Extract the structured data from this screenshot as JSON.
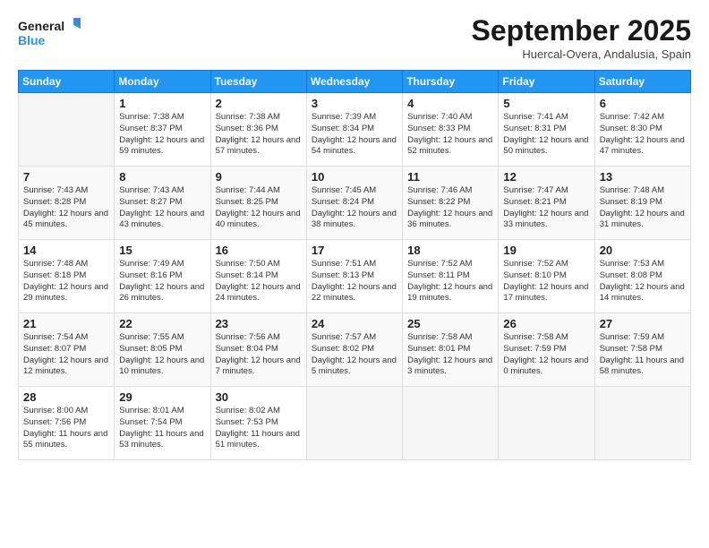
{
  "logo": {
    "line1": "General",
    "line2": "Blue"
  },
  "title": "September 2025",
  "location": "Huercal-Overa, Andalusia, Spain",
  "days_of_week": [
    "Sunday",
    "Monday",
    "Tuesday",
    "Wednesday",
    "Thursday",
    "Friday",
    "Saturday"
  ],
  "weeks": [
    [
      {
        "day": "",
        "sunrise": "",
        "sunset": "",
        "daylight": ""
      },
      {
        "day": "1",
        "sunrise": "Sunrise: 7:38 AM",
        "sunset": "Sunset: 8:37 PM",
        "daylight": "Daylight: 12 hours and 59 minutes."
      },
      {
        "day": "2",
        "sunrise": "Sunrise: 7:38 AM",
        "sunset": "Sunset: 8:36 PM",
        "daylight": "Daylight: 12 hours and 57 minutes."
      },
      {
        "day": "3",
        "sunrise": "Sunrise: 7:39 AM",
        "sunset": "Sunset: 8:34 PM",
        "daylight": "Daylight: 12 hours and 54 minutes."
      },
      {
        "day": "4",
        "sunrise": "Sunrise: 7:40 AM",
        "sunset": "Sunset: 8:33 PM",
        "daylight": "Daylight: 12 hours and 52 minutes."
      },
      {
        "day": "5",
        "sunrise": "Sunrise: 7:41 AM",
        "sunset": "Sunset: 8:31 PM",
        "daylight": "Daylight: 12 hours and 50 minutes."
      },
      {
        "day": "6",
        "sunrise": "Sunrise: 7:42 AM",
        "sunset": "Sunset: 8:30 PM",
        "daylight": "Daylight: 12 hours and 47 minutes."
      }
    ],
    [
      {
        "day": "7",
        "sunrise": "Sunrise: 7:43 AM",
        "sunset": "Sunset: 8:28 PM",
        "daylight": "Daylight: 12 hours and 45 minutes."
      },
      {
        "day": "8",
        "sunrise": "Sunrise: 7:43 AM",
        "sunset": "Sunset: 8:27 PM",
        "daylight": "Daylight: 12 hours and 43 minutes."
      },
      {
        "day": "9",
        "sunrise": "Sunrise: 7:44 AM",
        "sunset": "Sunset: 8:25 PM",
        "daylight": "Daylight: 12 hours and 40 minutes."
      },
      {
        "day": "10",
        "sunrise": "Sunrise: 7:45 AM",
        "sunset": "Sunset: 8:24 PM",
        "daylight": "Daylight: 12 hours and 38 minutes."
      },
      {
        "day": "11",
        "sunrise": "Sunrise: 7:46 AM",
        "sunset": "Sunset: 8:22 PM",
        "daylight": "Daylight: 12 hours and 36 minutes."
      },
      {
        "day": "12",
        "sunrise": "Sunrise: 7:47 AM",
        "sunset": "Sunset: 8:21 PM",
        "daylight": "Daylight: 12 hours and 33 minutes."
      },
      {
        "day": "13",
        "sunrise": "Sunrise: 7:48 AM",
        "sunset": "Sunset: 8:19 PM",
        "daylight": "Daylight: 12 hours and 31 minutes."
      }
    ],
    [
      {
        "day": "14",
        "sunrise": "Sunrise: 7:48 AM",
        "sunset": "Sunset: 8:18 PM",
        "daylight": "Daylight: 12 hours and 29 minutes."
      },
      {
        "day": "15",
        "sunrise": "Sunrise: 7:49 AM",
        "sunset": "Sunset: 8:16 PM",
        "daylight": "Daylight: 12 hours and 26 minutes."
      },
      {
        "day": "16",
        "sunrise": "Sunrise: 7:50 AM",
        "sunset": "Sunset: 8:14 PM",
        "daylight": "Daylight: 12 hours and 24 minutes."
      },
      {
        "day": "17",
        "sunrise": "Sunrise: 7:51 AM",
        "sunset": "Sunset: 8:13 PM",
        "daylight": "Daylight: 12 hours and 22 minutes."
      },
      {
        "day": "18",
        "sunrise": "Sunrise: 7:52 AM",
        "sunset": "Sunset: 8:11 PM",
        "daylight": "Daylight: 12 hours and 19 minutes."
      },
      {
        "day": "19",
        "sunrise": "Sunrise: 7:52 AM",
        "sunset": "Sunset: 8:10 PM",
        "daylight": "Daylight: 12 hours and 17 minutes."
      },
      {
        "day": "20",
        "sunrise": "Sunrise: 7:53 AM",
        "sunset": "Sunset: 8:08 PM",
        "daylight": "Daylight: 12 hours and 14 minutes."
      }
    ],
    [
      {
        "day": "21",
        "sunrise": "Sunrise: 7:54 AM",
        "sunset": "Sunset: 8:07 PM",
        "daylight": "Daylight: 12 hours and 12 minutes."
      },
      {
        "day": "22",
        "sunrise": "Sunrise: 7:55 AM",
        "sunset": "Sunset: 8:05 PM",
        "daylight": "Daylight: 12 hours and 10 minutes."
      },
      {
        "day": "23",
        "sunrise": "Sunrise: 7:56 AM",
        "sunset": "Sunset: 8:04 PM",
        "daylight": "Daylight: 12 hours and 7 minutes."
      },
      {
        "day": "24",
        "sunrise": "Sunrise: 7:57 AM",
        "sunset": "Sunset: 8:02 PM",
        "daylight": "Daylight: 12 hours and 5 minutes."
      },
      {
        "day": "25",
        "sunrise": "Sunrise: 7:58 AM",
        "sunset": "Sunset: 8:01 PM",
        "daylight": "Daylight: 12 hours and 3 minutes."
      },
      {
        "day": "26",
        "sunrise": "Sunrise: 7:58 AM",
        "sunset": "Sunset: 7:59 PM",
        "daylight": "Daylight: 12 hours and 0 minutes."
      },
      {
        "day": "27",
        "sunrise": "Sunrise: 7:59 AM",
        "sunset": "Sunset: 7:58 PM",
        "daylight": "Daylight: 11 hours and 58 minutes."
      }
    ],
    [
      {
        "day": "28",
        "sunrise": "Sunrise: 8:00 AM",
        "sunset": "Sunset: 7:56 PM",
        "daylight": "Daylight: 11 hours and 55 minutes."
      },
      {
        "day": "29",
        "sunrise": "Sunrise: 8:01 AM",
        "sunset": "Sunset: 7:54 PM",
        "daylight": "Daylight: 11 hours and 53 minutes."
      },
      {
        "day": "30",
        "sunrise": "Sunrise: 8:02 AM",
        "sunset": "Sunset: 7:53 PM",
        "daylight": "Daylight: 11 hours and 51 minutes."
      },
      {
        "day": "",
        "sunrise": "",
        "sunset": "",
        "daylight": ""
      },
      {
        "day": "",
        "sunrise": "",
        "sunset": "",
        "daylight": ""
      },
      {
        "day": "",
        "sunrise": "",
        "sunset": "",
        "daylight": ""
      },
      {
        "day": "",
        "sunrise": "",
        "sunset": "",
        "daylight": ""
      }
    ]
  ]
}
